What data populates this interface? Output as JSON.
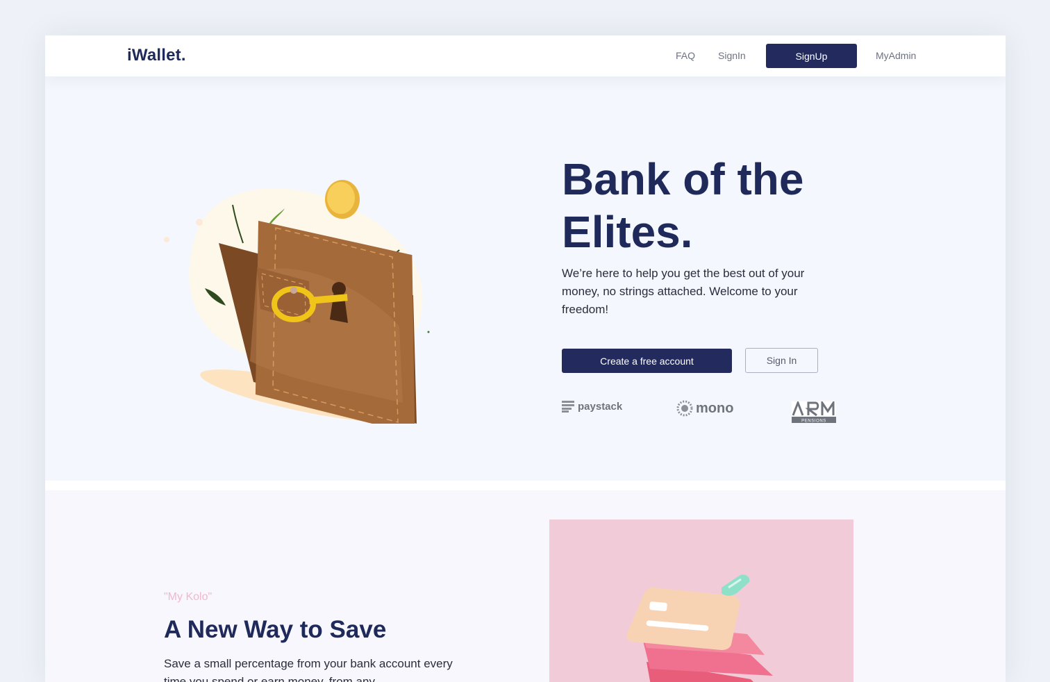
{
  "brand": {
    "logo": "iWallet."
  },
  "nav": {
    "faq": "FAQ",
    "signin": "SignIn",
    "signup": "SignUp",
    "myadmin": "MyAdmin"
  },
  "hero": {
    "title_line1": "Bank of the",
    "title_line2": "Elites.",
    "subtitle": "We’re here to help you get the best out of your money, no strings attached. Welcome to your freedom!",
    "cta_primary": "Create a free account",
    "cta_secondary": "Sign In"
  },
  "partners": [
    {
      "name": "paystack"
    },
    {
      "name": "mono"
    },
    {
      "name": "ARM",
      "sub": "PENSIONS"
    }
  ],
  "save_section": {
    "tag": "\"My Kolo\"",
    "title": "A New Way to Save",
    "description": "Save a small percentage from your bank account every time you spend or earn money, from any"
  },
  "colors": {
    "primary": "#222a5e",
    "heading": "#1f2a5a",
    "hero_bg": "#f4f7fd",
    "accent_pink": "#f0b8cc",
    "card_bg": "#f2cbd8"
  }
}
